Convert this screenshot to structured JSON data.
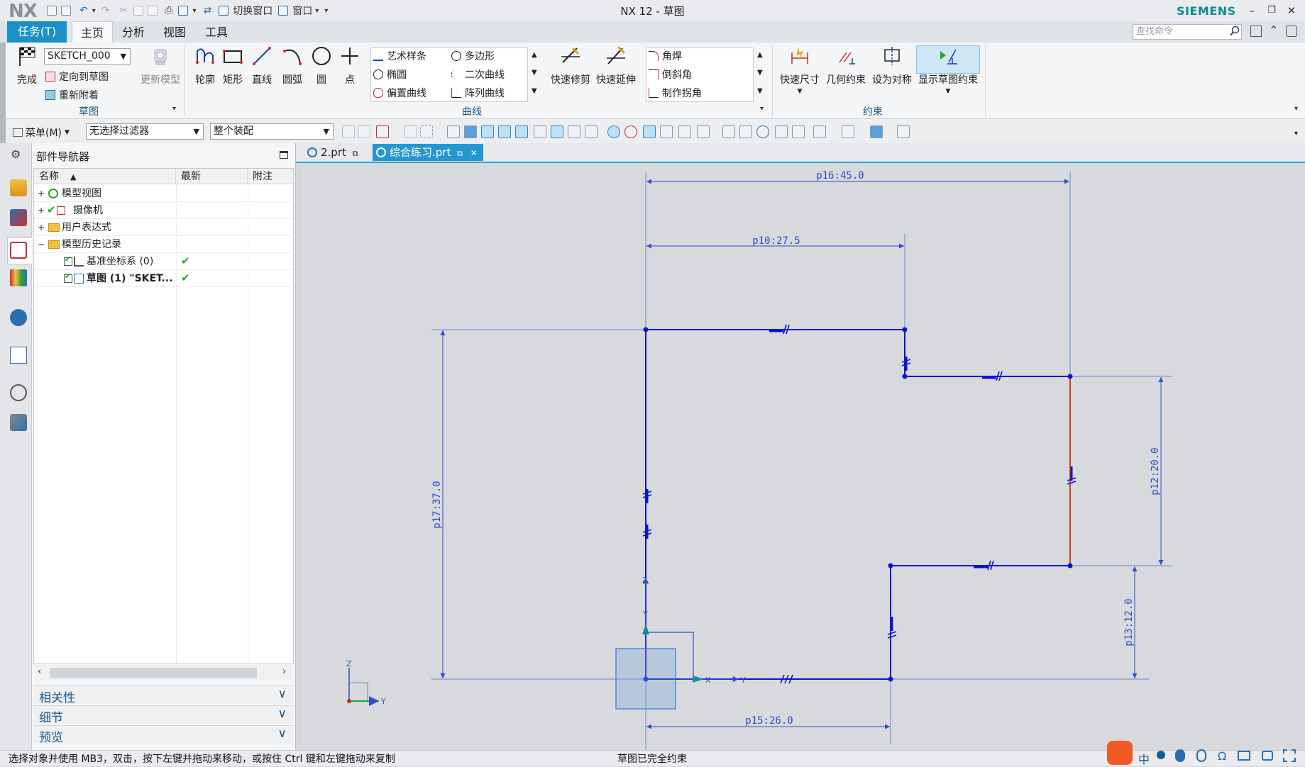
{
  "titlebar": {
    "logo": "NX",
    "title": "NX 12 - 草图",
    "brand": "SIEMENS",
    "switch_window": "切换窗口",
    "window_menu": "窗口"
  },
  "menu": {
    "task": "任务(T)",
    "tabs": [
      "主页",
      "分析",
      "视图",
      "工具"
    ],
    "search_placeholder": "查找命令"
  },
  "ribbon": {
    "sketch_group": {
      "finish": "完成",
      "sketch_name": "SKETCH_000",
      "orient": "定向到草图",
      "reattach": "重新附着",
      "update_model": "更新模型",
      "label": "草图"
    },
    "curve_group": {
      "tools": [
        "轮廓",
        "矩形",
        "直线",
        "圆弧",
        "圆",
        "点"
      ],
      "gallery": [
        "艺术样条",
        "多边形",
        "椭圆",
        "二次曲线",
        "偏置曲线",
        "阵列曲线"
      ],
      "quick_trim": "快速修剪",
      "quick_extend": "快速延伸",
      "edit": [
        "角焊",
        "倒斜角",
        "制作拐角"
      ],
      "label": "曲线"
    },
    "constraint_group": {
      "rapid_dim": "快速尺寸",
      "geo_con": "几何约束",
      "symmetric": "设为对称",
      "show_con": "显示草图约束",
      "label": "约束"
    }
  },
  "toolbar2": {
    "menu": "菜单(M)",
    "filter": "无选择过滤器",
    "assembly": "整个装配"
  },
  "navigator": {
    "title": "部件导航器",
    "columns": [
      "名称",
      "最新",
      "附注"
    ],
    "rows": [
      {
        "name": "模型视图",
        "latest": ""
      },
      {
        "name": "摄像机",
        "latest": ""
      },
      {
        "name": "用户表达式",
        "latest": ""
      },
      {
        "name": "模型历史记录",
        "latest": ""
      },
      {
        "name": "基准坐标系 (0)",
        "latest": "✔"
      },
      {
        "name": "草图 (1) \"SKET...",
        "latest": "✔"
      }
    ],
    "panels": [
      "相关性",
      "细节",
      "预览"
    ]
  },
  "tabs": [
    "2.prt",
    "综合练习.prt"
  ],
  "canvas": {
    "dims": [
      "p16:45.0",
      "p10:27.5",
      "p17:37.0",
      "p12:20.0",
      "p13:12.0",
      "p15:26.0"
    ],
    "axes": {
      "z": "Z",
      "y": "Y",
      "x": "X"
    }
  },
  "status": {
    "left": "选择对象并使用 MB3，双击，按下左键并拖动来移动，或按住 Ctrl 键和左键拖动来复制",
    "center": "草图已完全约束"
  },
  "colors": {
    "accent": "#1b8fc8",
    "sketch": "#0a14d0",
    "highlight": "#e03a28"
  }
}
